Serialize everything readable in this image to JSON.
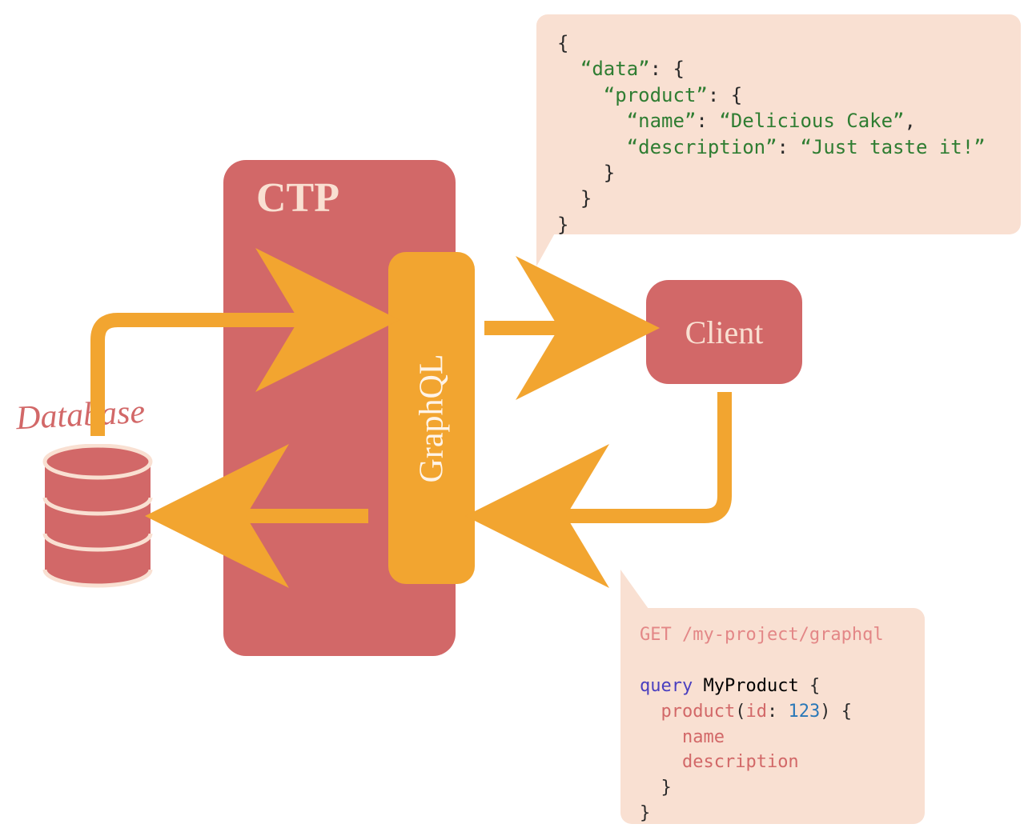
{
  "diagram": {
    "database_label": "Database",
    "ctp_label": "CTP",
    "graphql_label": "GraphQL",
    "client_label": "Client"
  },
  "response": {
    "line1": "{",
    "line2_key": "“data”",
    "line2_rest": ": {",
    "line3_key": "“product”",
    "line3_rest": ": {",
    "line4_key": "“name”",
    "line4_sep": ": ",
    "line4_val": "“Delicious Cake”",
    "line4_end": ",",
    "line5_key": "“description”",
    "line5_sep": ": ",
    "line5_val": "“Just taste it!”",
    "line6": "    }",
    "line7": "  }",
    "line8": "}"
  },
  "request": {
    "endpoint": "GET /my-project/graphql",
    "kw": "query",
    "op": "MyProduct",
    "brace_open": "{",
    "field_root": "product",
    "paren_open": "(",
    "arg_key": "id",
    "arg_colon": ": ",
    "arg_val": "123",
    "paren_close": ")",
    "brace_open2": "{",
    "field1": "name",
    "field2": "description",
    "brace_close2": "  }",
    "brace_close": "}"
  },
  "colors": {
    "pink": "#d26868",
    "cream": "#f9e0d2",
    "orange": "#f2a530",
    "green": "#2f7d32",
    "blue": "#2a78b8",
    "purple": "#4a3fbf"
  }
}
